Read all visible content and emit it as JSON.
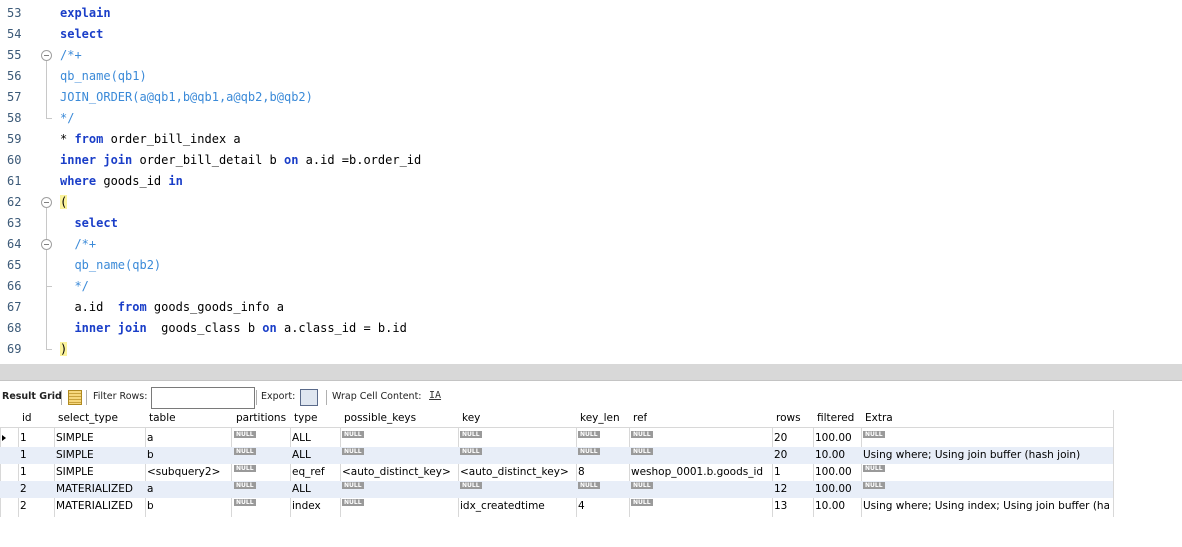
{
  "editor": {
    "lines": [
      {
        "n": "53",
        "html": "<span class='kw'>explain</span>"
      },
      {
        "n": "54",
        "html": "<span class='kw'>select</span>"
      },
      {
        "n": "55",
        "html": "<span class='cm'>/*+</span>"
      },
      {
        "n": "56",
        "html": "<span class='cm'>qb_name(qb1)</span>"
      },
      {
        "n": "57",
        "html": "<span class='cm'>JOIN_ORDER(a@qb1,b@qb1,a@qb2,b@qb2)</span>"
      },
      {
        "n": "58",
        "html": "<span class='cm'>*/</span>"
      },
      {
        "n": "59",
        "html": "* <span class='kw'>from</span> order_bill_index a"
      },
      {
        "n": "60",
        "html": "<span class='kw'>inner join</span> order_bill_detail b <span class='kw'>on</span> a.id =b.order_id"
      },
      {
        "n": "61",
        "html": "<span class='kw'>where</span> goods_id <span class='kw'>in</span>"
      },
      {
        "n": "62",
        "html": "<span class='paren'>(</span>"
      },
      {
        "n": "63",
        "html": "  <span class='kw'>select</span>"
      },
      {
        "n": "64",
        "html": "  <span class='cm'>/*+</span>"
      },
      {
        "n": "65",
        "html": "  <span class='cm'>qb_name(qb2)</span>"
      },
      {
        "n": "66",
        "html": "  <span class='cm'>*/</span>"
      },
      {
        "n": "67",
        "html": "  a.id  <span class='kw'>from</span> goods_goods_info a"
      },
      {
        "n": "68",
        "html": "  <span class='kw'>inner join</span>  goods_class b <span class='kw'>on</span> a.class_id = b.id"
      },
      {
        "n": "69",
        "html": "<span class='paren'>)</span>"
      }
    ]
  },
  "toolbar": {
    "result_grid": "Result Grid",
    "filter_rows": "Filter Rows:",
    "filter_value": "",
    "export": "Export:",
    "wrap": "Wrap Cell Content:",
    "grid_icon": "grid-icon",
    "export_icon": "export-icon",
    "wrap_icon": "wrap-text-icon",
    "wrap_glyph": "IA"
  },
  "table": {
    "columns": [
      "id",
      "select_type",
      "table",
      "partitions",
      "type",
      "possible_keys",
      "key",
      "key_len",
      "ref",
      "rows",
      "filtered",
      "Extra"
    ],
    "null_label": "NULL",
    "rows": [
      [
        "1",
        "SIMPLE",
        "a",
        null,
        "ALL",
        null,
        null,
        null,
        null,
        "20",
        "100.00",
        null
      ],
      [
        "1",
        "SIMPLE",
        "b",
        null,
        "ALL",
        null,
        null,
        null,
        null,
        "20",
        "10.00",
        "Using where; Using join buffer (hash join)"
      ],
      [
        "1",
        "SIMPLE",
        "<subquery2>",
        null,
        "eq_ref",
        "<auto_distinct_key>",
        "<auto_distinct_key>",
        "8",
        "weshop_0001.b.goods_id",
        "1",
        "100.00",
        null
      ],
      [
        "2",
        "MATERIALIZED",
        "a",
        null,
        "ALL",
        null,
        null,
        null,
        null,
        "12",
        "100.00",
        null
      ],
      [
        "2",
        "MATERIALIZED",
        "b",
        null,
        "index",
        null,
        "idx_createdtime",
        "4",
        null,
        "13",
        "10.00",
        "Using where; Using index; Using join buffer (ha..."
      ]
    ]
  }
}
